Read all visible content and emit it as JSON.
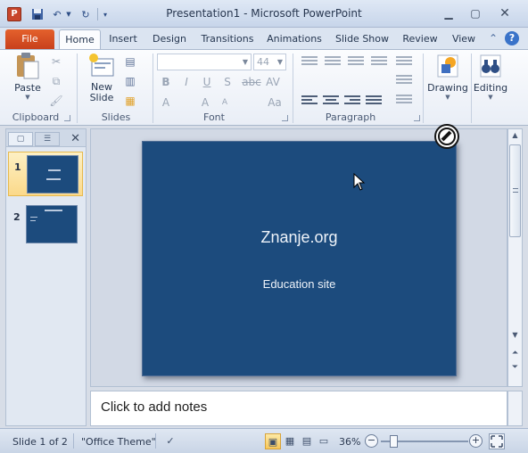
{
  "window": {
    "app_icon_letter": "P",
    "title": "Presentation1  -  Microsoft PowerPoint"
  },
  "tabs": {
    "file": "File",
    "items": [
      "Home",
      "Insert",
      "Design",
      "Transitions",
      "Animations",
      "Slide Show",
      "Review",
      "View"
    ],
    "active": "Home"
  },
  "ribbon": {
    "clipboard": {
      "label": "Clipboard",
      "paste": "Paste"
    },
    "slides": {
      "label": "Slides",
      "new_slide": "New Slide"
    },
    "font": {
      "label": "Font",
      "font_name": "",
      "font_size": "44"
    },
    "paragraph": {
      "label": "Paragraph"
    },
    "drawing": "Drawing",
    "editing": "Editing"
  },
  "thumbnails": [
    {
      "number": "1",
      "selected": true
    },
    {
      "number": "2",
      "selected": false
    }
  ],
  "slide": {
    "title": "Znanje.org",
    "subtitle": "Education site"
  },
  "notes": {
    "placeholder": "Click to add notes"
  },
  "status": {
    "slide_info": "Slide 1 of 2",
    "theme": "\"Office Theme\"",
    "zoom": "36%",
    "zoom_fraction": 0.36
  },
  "colors": {
    "slide_background": "#1c4b7d",
    "file_tab": "#d4502a",
    "accent": "#2d4e86"
  }
}
